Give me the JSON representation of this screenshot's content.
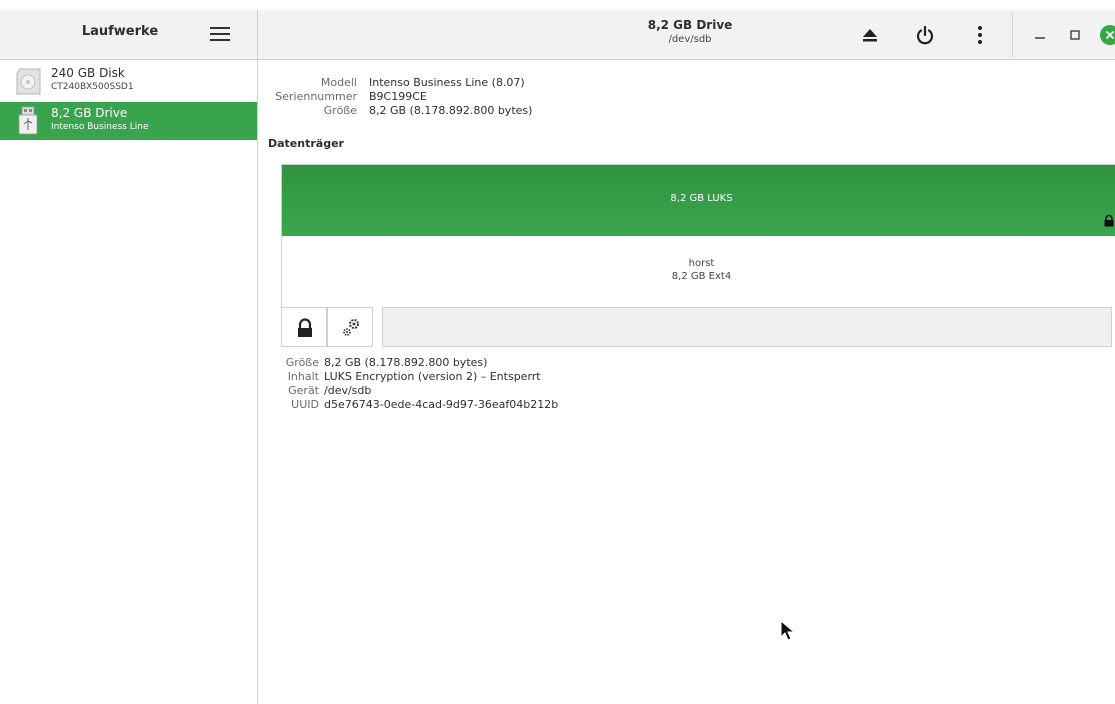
{
  "sidebar": {
    "title": "Laufwerke",
    "drives": [
      {
        "name": "240 GB Disk",
        "desc": "CT240BX500SSD1",
        "icon": "hdd-icon",
        "selected": false
      },
      {
        "name": "8,2 GB Drive",
        "desc": "Intenso Business Line",
        "icon": "usb-drive-icon",
        "selected": true
      }
    ]
  },
  "header": {
    "title": "8,2 GB Drive",
    "subtitle": "/dev/sdb",
    "icons": [
      "eject-icon",
      "power-icon",
      "more-vertical-icon",
      "minimize-icon",
      "maximize-icon",
      "close-icon"
    ]
  },
  "drive_info": {
    "model_label": "Modell",
    "model_value": "Intenso Business Line (8.07)",
    "serial_label": "Seriennummer",
    "serial_value": "B9C199CE",
    "size_label": "Größe",
    "size_value": "8,2 GB (8.178.892.800 bytes)"
  },
  "volumes": {
    "section_title": "Datenträger",
    "luks_label": "8,2 GB LUKS",
    "inner_name": "horst",
    "inner_desc": "8,2 GB Ext4"
  },
  "volume_info": {
    "size_label": "Größe",
    "size_value": "8,2 GB (8.178.892.800 bytes)",
    "content_label": "Inhalt",
    "content_value": "LUKS Encryption (version 2) – Entsperrt",
    "device_label": "Gerät",
    "device_value": "/dev/sdb",
    "uuid_label": "UUID",
    "uuid_value": "d5e76743-0ede-4cad-9d97-36eaf04b212b"
  },
  "colors": {
    "accent": "#3aa34d",
    "luks_bar": "#35a046",
    "close_button": "#35a746"
  }
}
